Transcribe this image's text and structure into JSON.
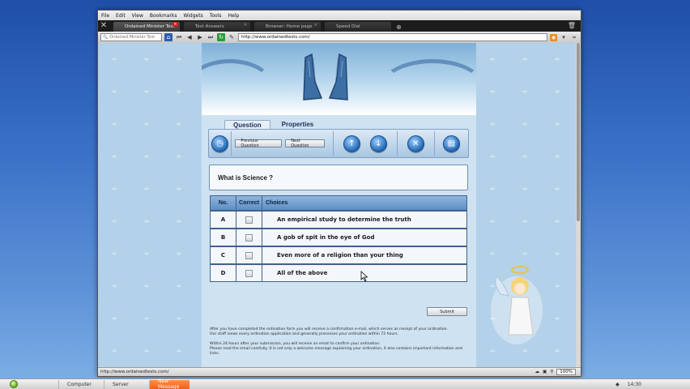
{
  "browser": {
    "menu": [
      "File",
      "Edit",
      "View",
      "Bookmarks",
      "Widgets",
      "Tools",
      "Help"
    ],
    "tabs": [
      {
        "label": "Ordained Minister Test",
        "active": true
      },
      {
        "label": "Test Answers",
        "active": false
      },
      {
        "label": "Browser: Home page",
        "active": false
      },
      {
        "label": "Speed Dial",
        "active": false
      }
    ],
    "search_placeholder": "Ordained Minister Test",
    "url": "http://www.ordainedtests.com/",
    "status_url": "http://www.ordainedtests.com/",
    "zoom": "100%"
  },
  "page": {
    "tabs": [
      "Question",
      "Properties"
    ],
    "prev_button": "Previous Question",
    "next_button": "Next Question",
    "question": "What is Science ?",
    "table_headers": {
      "no": "No.",
      "correct": "Correct",
      "choices": "Choices"
    },
    "choices": [
      {
        "no": "A",
        "text": "An empirical study to determine the truth"
      },
      {
        "no": "B",
        "text": "A gob of spit in the eye of God"
      },
      {
        "no": "C",
        "text": "Even more of a religion than your thing"
      },
      {
        "no": "D",
        "text": "All of the above"
      }
    ],
    "submit": "Submit",
    "info": [
      "After you have completed the ordination form you will receive a confirmation e-mail, which serves as receipt of your ordination.",
      "Our staff views every ordination application and generally processes your ordination within 72 hours.",
      "Within 24 hours after your submission, you will receive an email to confirm your ordination.",
      "Please read the email carefully. It is not only a welcome message explaining your ordination, it also contains important information and links."
    ]
  },
  "taskbar": {
    "items": [
      "Computer",
      "Server",
      "New Message"
    ],
    "clock": "14:30"
  },
  "colors": {
    "accent": "#1f66b6",
    "taskbar_active": "#f06018"
  }
}
